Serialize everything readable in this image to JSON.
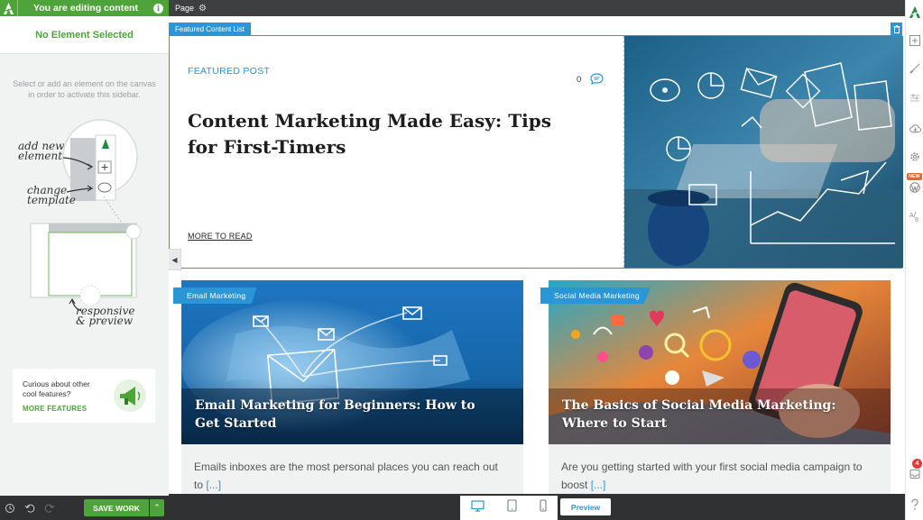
{
  "sidebar": {
    "header_title": "You are editing content",
    "no_element": "No Element Selected",
    "help_text": "Select or add an element on the canvas in order to activate this sidebar.",
    "tutorial": {
      "add_new": "add new element",
      "change_template": "change template",
      "responsive": "responsive & preview"
    },
    "promo": {
      "text": "Curious about other cool features?",
      "link": "MORE FEATURES"
    },
    "save_label": "SAVE WORK"
  },
  "topbar": {
    "label": "Page"
  },
  "canvas": {
    "element_label": "Featured Content List",
    "featured": {
      "kicker": "FEATURED POST",
      "comment_count": "0",
      "title": "Content Marketing Made Easy: Tips for First-Timers",
      "more_link": "MORE TO READ"
    },
    "cards": [
      {
        "tag": "Email Marketing",
        "title": "Email Marketing for Beginners: How to Get Started",
        "excerpt": "Emails inboxes are the most personal places you can reach out to",
        "more": "[...]"
      },
      {
        "tag": "Social Media Marketing",
        "title": "The Basics of Social Media Marketing: Where to Start",
        "excerpt": "Are you getting started with your first social media campaign to boost",
        "more": "[...]"
      }
    ]
  },
  "devices": {
    "preview_label": "Preview"
  },
  "rail": {
    "new_badge": "NEW",
    "notifications": "4"
  },
  "colors": {
    "brand_green": "#4ea33b",
    "accent_blue": "#2b96d6",
    "dark_bar": "#2f3133"
  }
}
